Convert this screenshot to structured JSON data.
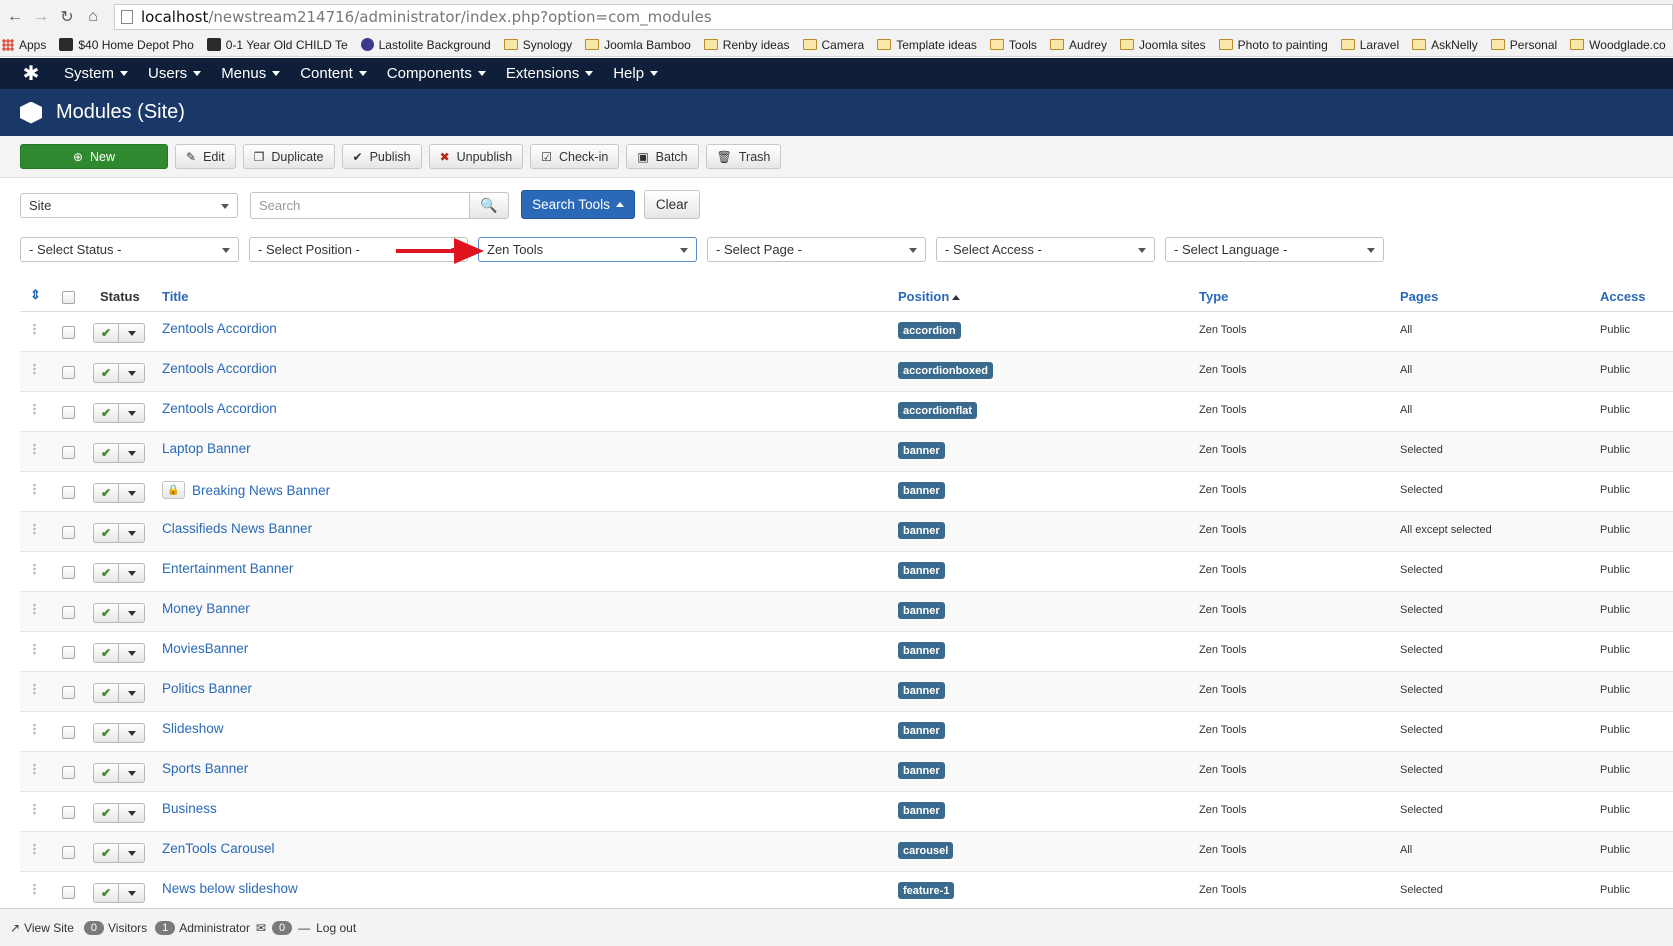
{
  "browser": {
    "url_host": "localhost",
    "url_path": "/newstream214716/administrator/index.php?option=com_modules",
    "bookmarks": [
      "Apps",
      "$40 Home Depot Pho",
      "0-1 Year Old CHILD Te",
      "Lastolite Background",
      "Synology",
      "Joomla Bamboo",
      "Renby ideas",
      "Camera",
      "Template ideas",
      "Tools",
      "Audrey",
      "Joomla sites",
      "Photo to painting",
      "Laravel",
      "AskNelly",
      "Personal",
      "Woodglade.co"
    ]
  },
  "nav": {
    "items": [
      "System",
      "Users",
      "Menus",
      "Content",
      "Components",
      "Extensions",
      "Help"
    ]
  },
  "header": {
    "title": "Modules (Site)"
  },
  "toolbar": {
    "new": "New",
    "edit": "Edit",
    "duplicate": "Duplicate",
    "publish": "Publish",
    "unpublish": "Unpublish",
    "checkin": "Check-in",
    "batch": "Batch",
    "trash": "Trash"
  },
  "filters": {
    "client": "Site",
    "search_placeholder": "Search",
    "search_tools": "Search Tools",
    "clear": "Clear",
    "status": "- Select Status -",
    "position": "- Select Position -",
    "module_type": "Zen Tools",
    "page": "- Select Page -",
    "access": "- Select Access -",
    "language": "- Select Language -"
  },
  "table": {
    "headers": {
      "status": "Status",
      "title": "Title",
      "position": "Position",
      "type": "Type",
      "pages": "Pages",
      "access": "Access"
    },
    "rows": [
      {
        "title": "Zentools Accordion",
        "position": "accordion",
        "type": "Zen Tools",
        "pages": "All",
        "access": "Public",
        "locked": false
      },
      {
        "title": "Zentools Accordion",
        "position": "accordionboxed",
        "type": "Zen Tools",
        "pages": "All",
        "access": "Public",
        "locked": false
      },
      {
        "title": "Zentools Accordion",
        "position": "accordionflat",
        "type": "Zen Tools",
        "pages": "All",
        "access": "Public",
        "locked": false
      },
      {
        "title": "Laptop Banner",
        "position": "banner",
        "type": "Zen Tools",
        "pages": "Selected",
        "access": "Public",
        "locked": false
      },
      {
        "title": "Breaking News Banner",
        "position": "banner",
        "type": "Zen Tools",
        "pages": "Selected",
        "access": "Public",
        "locked": true
      },
      {
        "title": "Classifieds News Banner",
        "position": "banner",
        "type": "Zen Tools",
        "pages": "All except selected",
        "access": "Public",
        "locked": false
      },
      {
        "title": "Entertainment Banner",
        "position": "banner",
        "type": "Zen Tools",
        "pages": "Selected",
        "access": "Public",
        "locked": false
      },
      {
        "title": "Money Banner",
        "position": "banner",
        "type": "Zen Tools",
        "pages": "Selected",
        "access": "Public",
        "locked": false
      },
      {
        "title": "MoviesBanner",
        "position": "banner",
        "type": "Zen Tools",
        "pages": "Selected",
        "access": "Public",
        "locked": false
      },
      {
        "title": "Politics Banner",
        "position": "banner",
        "type": "Zen Tools",
        "pages": "Selected",
        "access": "Public",
        "locked": false
      },
      {
        "title": "Slideshow",
        "position": "banner",
        "type": "Zen Tools",
        "pages": "Selected",
        "access": "Public",
        "locked": false
      },
      {
        "title": "Sports Banner",
        "position": "banner",
        "type": "Zen Tools",
        "pages": "Selected",
        "access": "Public",
        "locked": false
      },
      {
        "title": "Business",
        "position": "banner",
        "type": "Zen Tools",
        "pages": "Selected",
        "access": "Public",
        "locked": false
      },
      {
        "title": "ZenTools Carousel",
        "position": "carousel",
        "type": "Zen Tools",
        "pages": "All",
        "access": "Public",
        "locked": false
      },
      {
        "title": "News below slideshow",
        "position": "feature-1",
        "type": "Zen Tools",
        "pages": "Selected",
        "access": "Public",
        "locked": false
      }
    ]
  },
  "statusbar": {
    "view_site": "View Site",
    "visitors_count": "0",
    "visitors": "Visitors",
    "admin_count": "1",
    "administrator": "Administrator",
    "messages_count": "0",
    "logout": "Log out"
  },
  "colors": {
    "navbar": "#0f1f3a",
    "header": "#1a3867",
    "new_button": "#2f8a2f",
    "primary": "#2a69b8",
    "badge": "#3a6a8e",
    "arrow": "#e0141e"
  }
}
